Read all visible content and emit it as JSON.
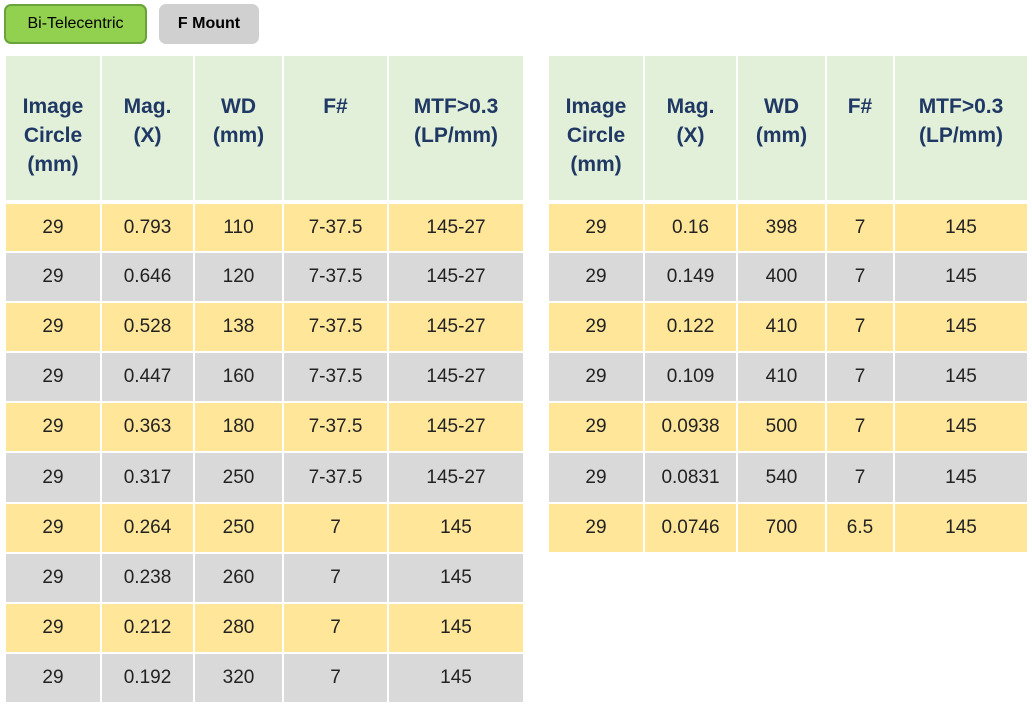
{
  "tags": {
    "category": "Bi-Telecentric",
    "mount": "F Mount"
  },
  "headers": [
    [
      "Image",
      "Circle",
      "(mm)"
    ],
    [
      "Mag.",
      "(X)"
    ],
    [
      "WD",
      "(mm)"
    ],
    [
      "F#"
    ],
    [
      "MTF>0.3",
      "(LP/mm)"
    ]
  ],
  "table_left": {
    "rows": [
      [
        "29",
        "0.793",
        "110",
        "7-37.5",
        "145-27"
      ],
      [
        "29",
        "0.646",
        "120",
        "7-37.5",
        "145-27"
      ],
      [
        "29",
        "0.528",
        "138",
        "7-37.5",
        "145-27"
      ],
      [
        "29",
        "0.447",
        "160",
        "7-37.5",
        "145-27"
      ],
      [
        "29",
        "0.363",
        "180",
        "7-37.5",
        "145-27"
      ],
      [
        "29",
        "0.317",
        "250",
        "7-37.5",
        "145-27"
      ],
      [
        "29",
        "0.264",
        "250",
        "7",
        "145"
      ],
      [
        "29",
        "0.238",
        "260",
        "7",
        "145"
      ],
      [
        "29",
        "0.212",
        "280",
        "7",
        "145"
      ],
      [
        "29",
        "0.192",
        "320",
        "7",
        "145"
      ]
    ]
  },
  "table_right": {
    "rows": [
      [
        "29",
        "0.16",
        "398",
        "7",
        "145"
      ],
      [
        "29",
        "0.149",
        "400",
        "7",
        "145"
      ],
      [
        "29",
        "0.122",
        "410",
        "7",
        "145"
      ],
      [
        "29",
        "0.109",
        "410",
        "7",
        "145"
      ],
      [
        "29",
        "0.0938",
        "500",
        "7",
        "145"
      ],
      [
        "29",
        "0.0831",
        "540",
        "7",
        "145"
      ],
      [
        "29",
        "0.0746",
        "700",
        "6.5",
        "145"
      ]
    ]
  },
  "colors": {
    "header_bg": "#e2efd9",
    "header_text": "#1f3864",
    "row_odd": "#ffe699",
    "row_even": "#d9d9d9",
    "tag_green": "#92d050",
    "tag_gray": "#d0d0d0"
  }
}
